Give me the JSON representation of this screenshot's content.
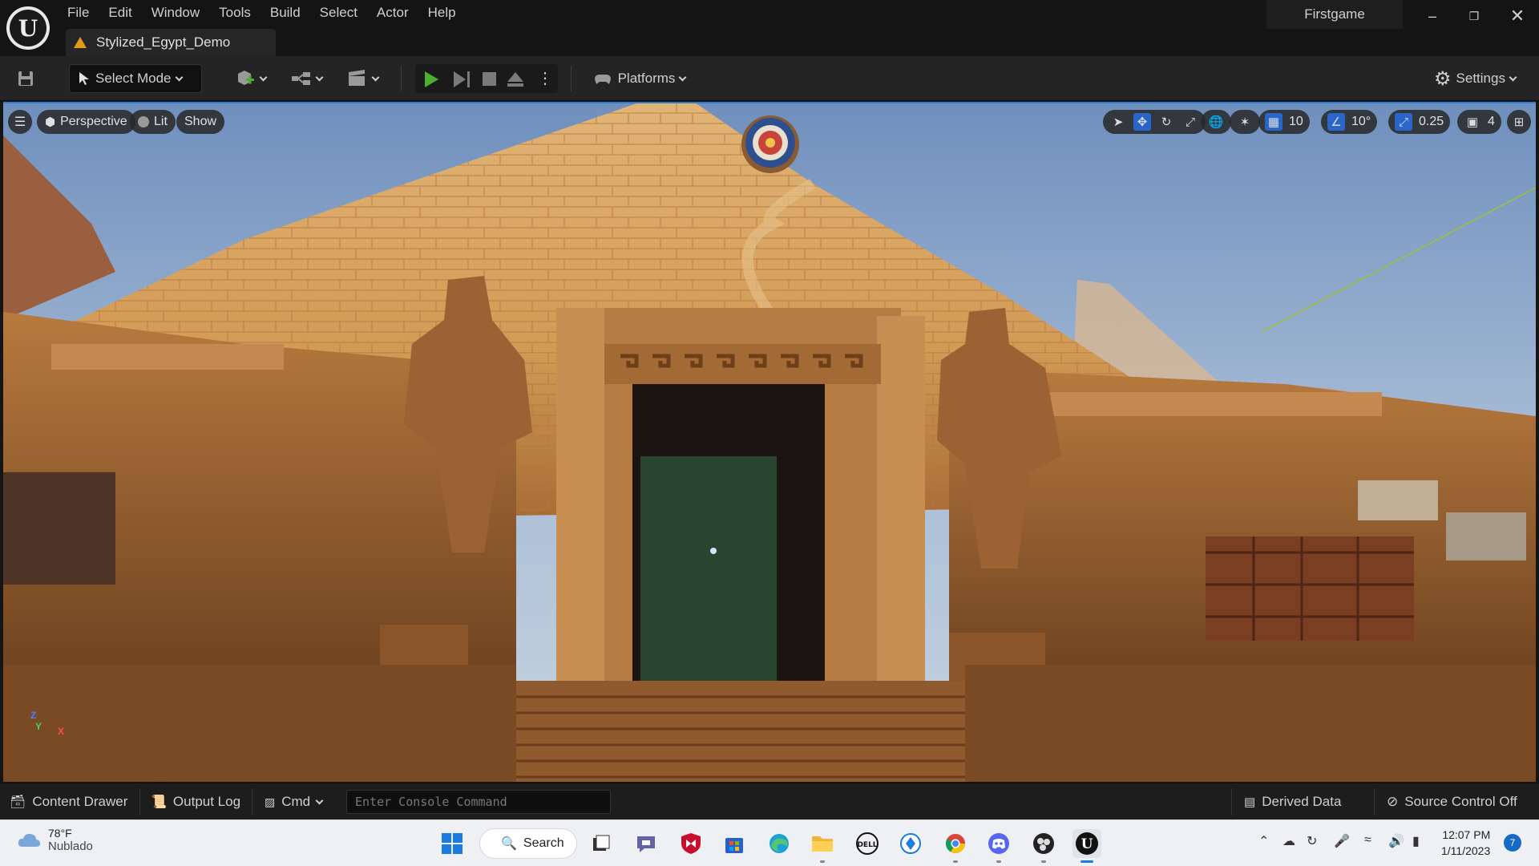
{
  "menu": [
    "File",
    "Edit",
    "Window",
    "Tools",
    "Build",
    "Select",
    "Actor",
    "Help"
  ],
  "document_tab": "Stylized_Egypt_Demo",
  "project_name": "Firstgame",
  "toolbar": {
    "select_mode": "Select Mode",
    "platforms": "Platforms",
    "settings": "Settings"
  },
  "viewport": {
    "perspective": "Perspective",
    "lit": "Lit",
    "show": "Show",
    "grid_snap": "10",
    "rotation_snap": "10°",
    "scale_snap": "0.25",
    "camera_speed": "4",
    "axis_z": "Z",
    "axis_y": "Y",
    "axis_x": "X"
  },
  "statusbar": {
    "content_drawer": "Content Drawer",
    "output_log": "Output Log",
    "cmd": "Cmd",
    "console_placeholder": "Enter Console Command",
    "derived_data": "Derived Data",
    "source_control": "Source Control Off"
  },
  "taskbar": {
    "temperature": "78°F",
    "condition": "Nublado",
    "search": "Search",
    "time": "12:07 PM",
    "date": "1/11/2023",
    "notifications": "7"
  },
  "colors": {
    "accent_blue": "#2a7fd6",
    "play_green": "#4caf2f",
    "warning_orange": "#e09a1c"
  }
}
